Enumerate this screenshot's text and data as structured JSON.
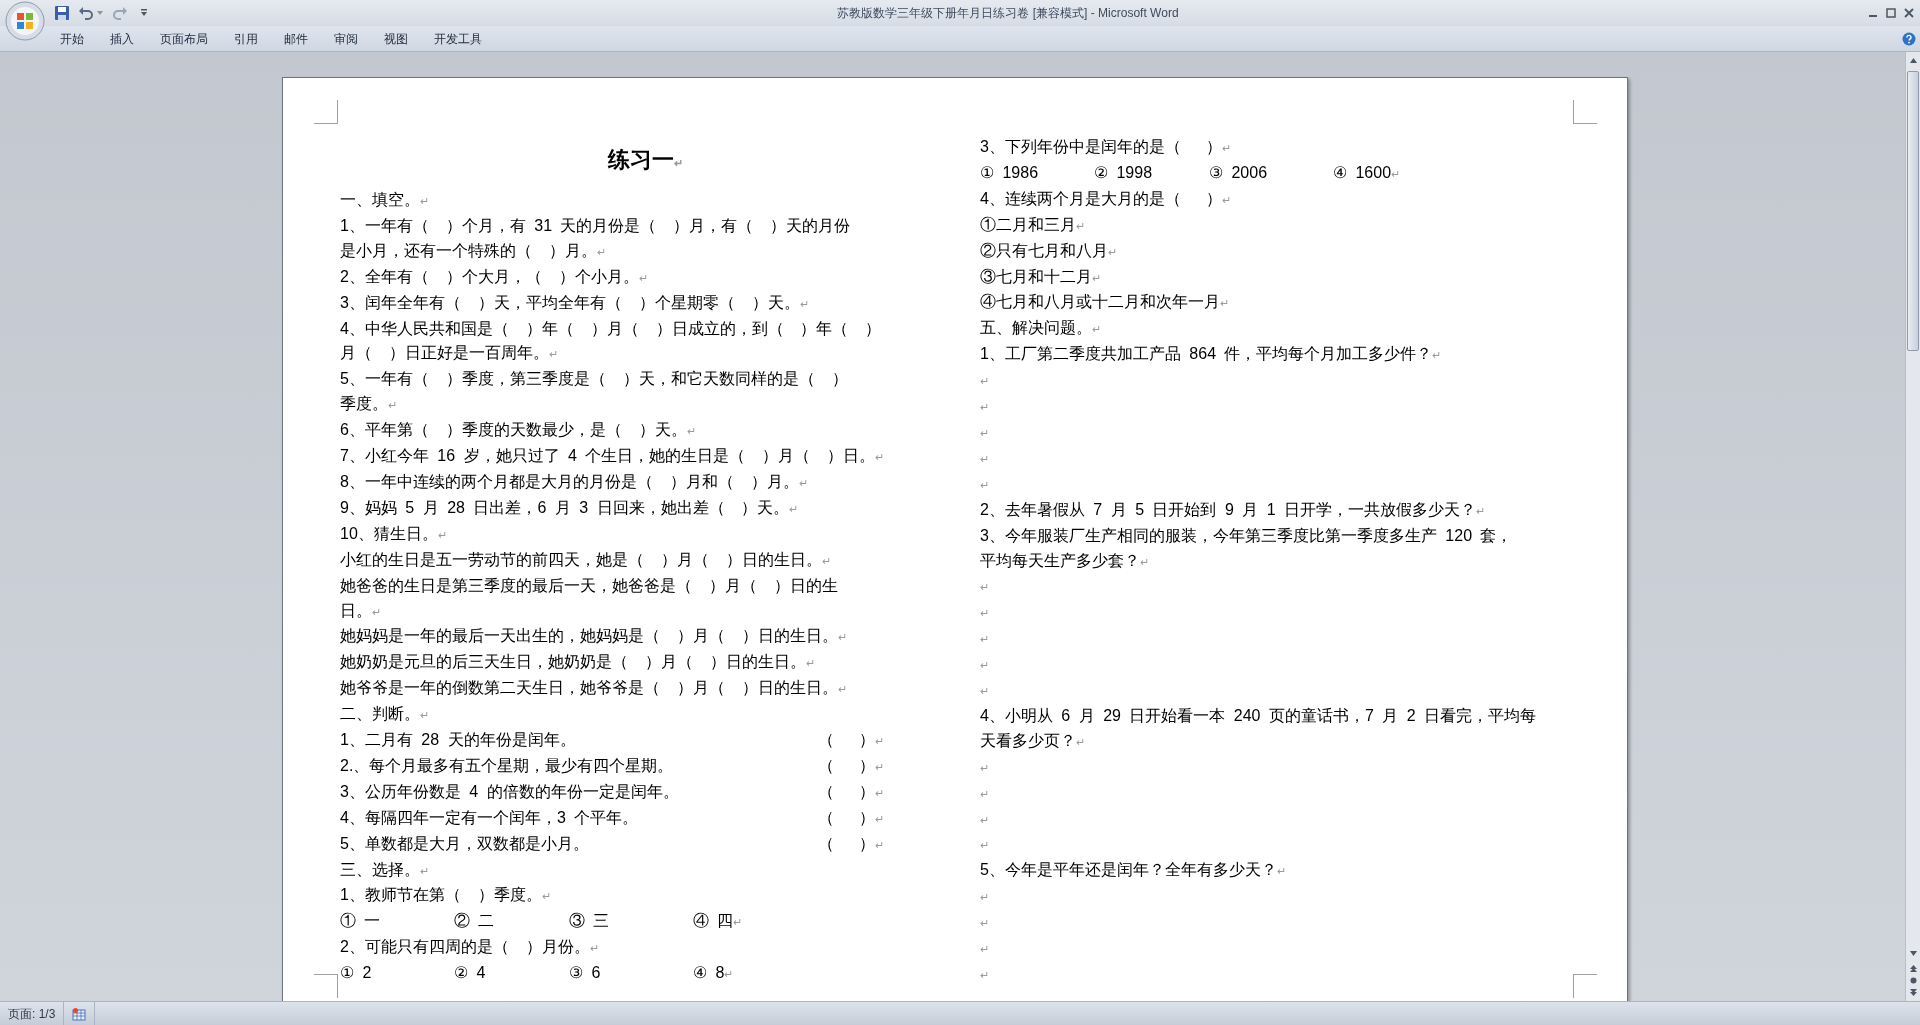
{
  "window": {
    "title": "苏教版数学三年级下册年月日练习卷 [兼容模式] - Microsoft Word"
  },
  "ribbon_tabs": [
    {
      "label": "开始"
    },
    {
      "label": "插入"
    },
    {
      "label": "页面布局"
    },
    {
      "label": "引用"
    },
    {
      "label": "邮件"
    },
    {
      "label": "审阅"
    },
    {
      "label": "视图"
    },
    {
      "label": "开发工具"
    }
  ],
  "document": {
    "columns": [
      [
        {
          "kind": "title",
          "text": "练习一",
          "end": "↵"
        },
        {
          "kind": "heading",
          "text": "一、填空。",
          "end": "↵"
        },
        {
          "kind": "text",
          "lines": [
            "1、一年有（  ）个月，有 31 天的月份是（  ）月，有（  ）天的月份",
            "是小月，还有一个特殊的（  ）月。"
          ],
          "end": "↵"
        },
        {
          "kind": "text",
          "text": "2、全年有（  ）个大月，（  ）个小月。",
          "end": "↵"
        },
        {
          "kind": "text",
          "text": "3、闰年全年有（  ）天，平均全年有（  ）个星期零（  ）天。",
          "end": "↵"
        },
        {
          "kind": "text",
          "lines": [
            "4、中华人民共和国是（  ）年（  ）月（  ）日成立的，到（  ）年（  ）",
            "月（  ）日正好是一百周年。"
          ],
          "end": "↵"
        },
        {
          "kind": "text",
          "lines": [
            "5、一年有（  ）季度，第三季度是（  ）天，和它天数同样的是（  ）",
            "季度。"
          ],
          "end": "↵"
        },
        {
          "kind": "text",
          "text": "6、平年第（  ）季度的天数最少，是（  ）天。",
          "end": "↵"
        },
        {
          "kind": "text",
          "text": "7、小红今年 16 岁，她只过了 4 个生日，她的生日是（  ）月（  ）日。",
          "end": "↵"
        },
        {
          "kind": "text",
          "text": "8、一年中连续的两个月都是大月的月份是（  ）月和（  ）月。",
          "end": "↵"
        },
        {
          "kind": "text",
          "text": "9、妈妈 5 月 28 日出差，6 月 3 日回来，她出差（  ）天。",
          "end": "↵"
        },
        {
          "kind": "text",
          "text": "10、猜生日。",
          "end": "↵"
        },
        {
          "kind": "text",
          "text": "小红的生日是五一劳动节的前四天，她是（  ）月（  ）日的生日。",
          "end": "↵"
        },
        {
          "kind": "text",
          "lines": [
            "她爸爸的生日是第三季度的最后一天，她爸爸是（  ）月（  ）日的生",
            "日。"
          ],
          "end": "↵"
        },
        {
          "kind": "text",
          "text": "她妈妈是一年的最后一天出生的，她妈妈是（  ）月（  ）日的生日。",
          "end": "↵"
        },
        {
          "kind": "text",
          "text": "她奶奶是元旦的后三天生日，她奶奶是（  ）月（  ）日的生日。",
          "end": "↵"
        },
        {
          "kind": "text",
          "text": "她爷爷是一年的倒数第二天生日，她爷爷是（  ）月（  ）日的生日。",
          "end": "↵"
        },
        {
          "kind": "heading",
          "text": "二、判断。",
          "end": "↵"
        },
        {
          "kind": "judge",
          "text": "1、二月有 28 天的年份是闰年。",
          "blank": "（   ）",
          "end": "↵"
        },
        {
          "kind": "judge",
          "text": "2.、每个月最多有五个星期，最少有四个星期。",
          "blank": "（   ）",
          "end": "↵"
        },
        {
          "kind": "judge",
          "text": "3、公历年份数是 4 的倍数的年份一定是闰年。",
          "blank": "（   ）",
          "end": "↵"
        },
        {
          "kind": "judge",
          "text": "4、每隔四年一定有一个闰年，3 个平年。",
          "blank": "（   ）",
          "end": "↵"
        },
        {
          "kind": "judge",
          "text": "5、单数都是大月，双数都是小月。",
          "blank": "（   ）",
          "end": "↵"
        },
        {
          "kind": "heading",
          "text": "三、选择。",
          "end": "↵"
        },
        {
          "kind": "text",
          "text": "1、教师节在第（  ）季度。",
          "end": "↵"
        },
        {
          "kind": "options",
          "options": [
            "① 一",
            "② 二",
            "③ 三",
            "④ 四"
          ],
          "end": "↵"
        },
        {
          "kind": "text",
          "text": "2、可能只有四周的是（  ）月份。",
          "end": "↵"
        },
        {
          "kind": "options",
          "options": [
            "① 2",
            "② 4",
            "③ 6",
            "④ 8"
          ],
          "end": "↵"
        }
      ],
      [
        {
          "kind": "text",
          "text": "3、下列年份中是闰年的是（   ）",
          "end": "↵"
        },
        {
          "kind": "options",
          "options": [
            "① 1986",
            "② 1998",
            "③ 2006",
            "④ 1600"
          ],
          "end": "↵"
        },
        {
          "kind": "text",
          "text": "4、连续两个月是大月的是（   ）",
          "end": "↵"
        },
        {
          "kind": "text",
          "text": "①二月和三月",
          "end": "↵"
        },
        {
          "kind": "text",
          "text": "②只有七月和八月",
          "end": "↵"
        },
        {
          "kind": "text",
          "text": "③七月和十二月",
          "end": "↵"
        },
        {
          "kind": "text",
          "text": "④七月和八月或十二月和次年一月",
          "end": "↵"
        },
        {
          "kind": "heading",
          "text": "五、解决问题。",
          "end": "↵"
        },
        {
          "kind": "text",
          "text": "1、工厂第二季度共加工产品 864 件，平均每个月加工多少件？",
          "end": "↵"
        },
        {
          "kind": "empty",
          "end": "↵"
        },
        {
          "kind": "empty",
          "end": "↵"
        },
        {
          "kind": "empty",
          "end": "↵"
        },
        {
          "kind": "empty",
          "end": "↵"
        },
        {
          "kind": "empty",
          "end": "↵"
        },
        {
          "kind": "text",
          "text": "2、去年暑假从 7 月 5 日开始到 9 月 1 日开学，一共放假多少天？",
          "end": "↵"
        },
        {
          "kind": "text",
          "lines": [
            "3、今年服装厂生产相同的服装，今年第三季度比第一季度多生产 120 套，",
            "平均每天生产多少套？"
          ],
          "end": "↵"
        },
        {
          "kind": "empty",
          "end": "↵"
        },
        {
          "kind": "empty",
          "end": "↵"
        },
        {
          "kind": "empty",
          "end": "↵"
        },
        {
          "kind": "empty",
          "end": "↵"
        },
        {
          "kind": "empty",
          "end": "↵"
        },
        {
          "kind": "text",
          "lines": [
            "4、小明从 6 月 29 日开始看一本 240 页的童话书，7 月 2 日看完，平均每",
            "天看多少页？"
          ],
          "end": "↵"
        },
        {
          "kind": "empty",
          "end": "↵"
        },
        {
          "kind": "empty",
          "end": "↵"
        },
        {
          "kind": "empty",
          "end": "↵"
        },
        {
          "kind": "empty",
          "end": "↵"
        },
        {
          "kind": "text",
          "text": "5、今年是平年还是闰年？全年有多少天？",
          "end": "↵"
        },
        {
          "kind": "empty",
          "end": "↵"
        },
        {
          "kind": "empty",
          "end": "↵"
        },
        {
          "kind": "empty",
          "end": "↵"
        },
        {
          "kind": "empty",
          "end": "↵"
        }
      ]
    ]
  },
  "status_bar": {
    "page": "页面: 1/3"
  }
}
